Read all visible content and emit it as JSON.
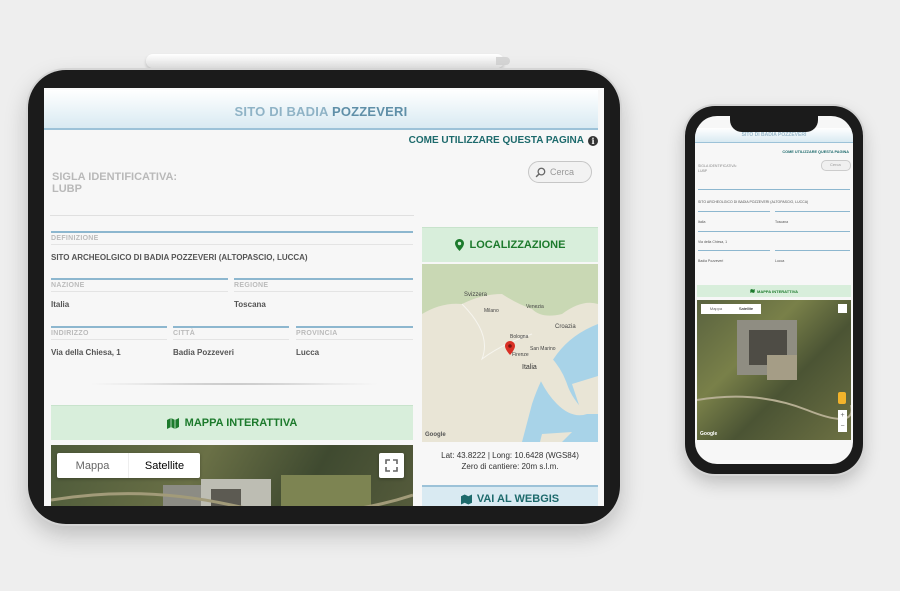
{
  "tablet": {
    "banner": {
      "title_prefix": "SITO DI BADIA ",
      "title_emphasis": "POZZEVERI"
    },
    "help_link": "COME UTILIZZARE QUESTA PAGINA",
    "sigla": {
      "label": "SIGLA IDENTIFICATIVA:",
      "value": "LUBP"
    },
    "search": {
      "placeholder": "Cerca"
    },
    "fields": {
      "definizione": {
        "label": "DEFINIZIONE",
        "value": "SITO ARCHEOLGICO DI BADIA POZZEVERI (ALTOPASCIO, LUCCA)"
      },
      "nazione": {
        "label": "NAZIONE",
        "value": "Italia"
      },
      "regione": {
        "label": "REGIONE",
        "value": "Toscana"
      },
      "indirizzo": {
        "label": "INDIRIZZO",
        "value": "Via della Chiesa, 1"
      },
      "citta": {
        "label": "CITTÀ",
        "value": "Badia Pozzeveri"
      },
      "provincia": {
        "label": "PROVINCIA",
        "value": "Lucca"
      }
    },
    "mappa_interattiva": "MAPPA INTERATTIVA",
    "map_controls": {
      "mappa": "Mappa",
      "satellite": "Satellite"
    },
    "localizzazione": "LOCALIZZAZIONE",
    "loc_map_labels": {
      "svizzera": "Svizzera",
      "italia": "Italia",
      "croazia": "Croazia",
      "milano": "Milano",
      "venezia": "Venezia",
      "bologna": "Bologna",
      "firenze": "Firenze",
      "san_marino": "San Marino",
      "google": "Google"
    },
    "coords": {
      "line1": "Lat: 43.8222 | Long: 10.6428 (WGS84)",
      "line2": "Zero di cantiere: 20m s.l.m."
    },
    "webgis": "VAI AL WEBGIS"
  },
  "phone": {
    "banner": "SITO DI BADIA POZZEVERI",
    "help_link": "COME UTILIZZARE QUESTA PAGINA",
    "sigla_label": "SIGLA IDENTIFICATIVA:",
    "sigla_value": "LUBP",
    "search_placeholder": "Cerca",
    "definizione": "SITO ARCHEOLGICO DI BADIA POZZEVERI (ALTOPASCIO, LUCCA)",
    "nazione": "Italia",
    "regione": "Toscana",
    "indirizzo": "Via della Chiesa, 1",
    "citta": "Badia Pozzeveri",
    "provincia": "Lucca",
    "mappa_interattiva": "MAPPA INTERATTIVA",
    "map_mappa": "Mappa",
    "map_satellite": "Satellite",
    "google": "Google"
  },
  "colors": {
    "accent_blue": "#8db7cf",
    "accent_green": "#1c7a2c",
    "teal": "#1d6a6c",
    "marker_red": "#d93025"
  }
}
